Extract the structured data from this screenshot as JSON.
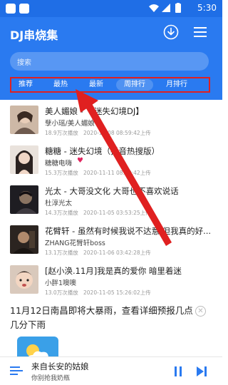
{
  "status_bar": {
    "time": "5:30"
  },
  "header": {
    "title": "DJ串烧集",
    "search_placeholder": "搜索",
    "tabs": [
      "推荐",
      "最热",
      "最新",
      "周排行",
      "月排行"
    ],
    "selected_tab": "周排行"
  },
  "songs": [
    {
      "title": "美人媚娘 - 【迷失幻境DJ】",
      "artist": "孽小瑶/美人媚娘",
      "plays": "18.9万次播放",
      "date": "2020-11-08 08:59:42上传"
    },
    {
      "title": "糖糖 - 迷失幻境（抖音热搜版）",
      "artist": "糖糖电嗨",
      "plays": "15.3万次播放",
      "date": "2020-11-11 08:00:42上传"
    },
    {
      "title": "光太 - 大哥没文化 大哥也不喜欢说话",
      "artist": "杜淳光太",
      "plays": "14.3万次播放",
      "date": "2020-11-05 03:53:25上传"
    },
    {
      "title": "花臂轩 - 虽然有时候我说不达意 但我真的好...",
      "artist": "ZHANG花臂轩boss",
      "plays": "13.1万次播放",
      "date": "2020-11-06 03:42:28上传"
    },
    {
      "title": "[赵小涣.11月]我是真的爱你 暗里着迷",
      "artist": "小胖1噢噢",
      "plays": "13.0万次播放",
      "date": "2020-11-05 15:26:02上传"
    }
  ],
  "news": {
    "text": "11月12日南昌即将大暴雨，查看详细预报几点几分下雨"
  },
  "player": {
    "title": "来自长安的姑娘",
    "artist": "你别抢我奶瓶"
  },
  "colors": {
    "primary": "#2a7af0",
    "status": "#1f6ee6",
    "annotation": "#e02020"
  }
}
